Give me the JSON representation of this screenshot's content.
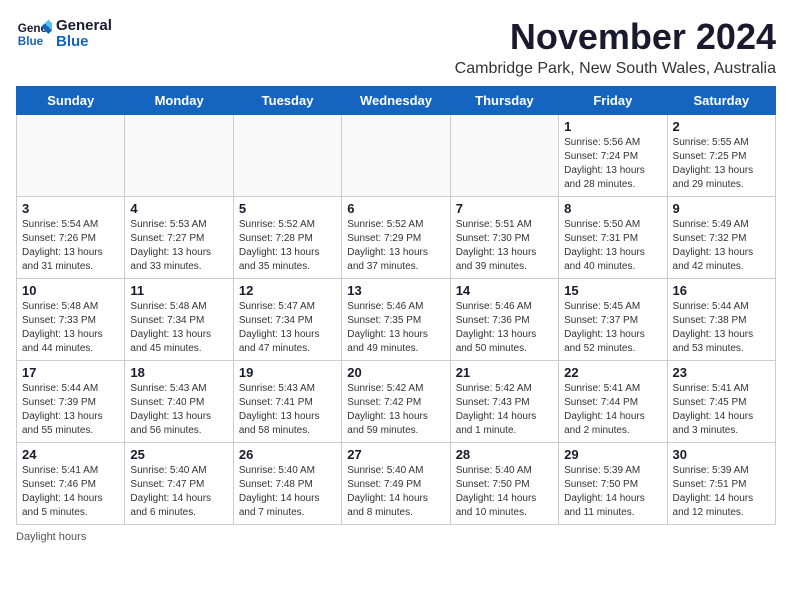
{
  "header": {
    "logo_line1": "General",
    "logo_line2": "Blue",
    "main_title": "November 2024",
    "subtitle": "Cambridge Park, New South Wales, Australia"
  },
  "calendar": {
    "days_of_week": [
      "Sunday",
      "Monday",
      "Tuesday",
      "Wednesday",
      "Thursday",
      "Friday",
      "Saturday"
    ],
    "weeks": [
      [
        {
          "date": "",
          "info": ""
        },
        {
          "date": "",
          "info": ""
        },
        {
          "date": "",
          "info": ""
        },
        {
          "date": "",
          "info": ""
        },
        {
          "date": "",
          "info": ""
        },
        {
          "date": "1",
          "info": "Sunrise: 5:56 AM\nSunset: 7:24 PM\nDaylight: 13 hours and 28 minutes."
        },
        {
          "date": "2",
          "info": "Sunrise: 5:55 AM\nSunset: 7:25 PM\nDaylight: 13 hours and 29 minutes."
        }
      ],
      [
        {
          "date": "3",
          "info": "Sunrise: 5:54 AM\nSunset: 7:26 PM\nDaylight: 13 hours and 31 minutes."
        },
        {
          "date": "4",
          "info": "Sunrise: 5:53 AM\nSunset: 7:27 PM\nDaylight: 13 hours and 33 minutes."
        },
        {
          "date": "5",
          "info": "Sunrise: 5:52 AM\nSunset: 7:28 PM\nDaylight: 13 hours and 35 minutes."
        },
        {
          "date": "6",
          "info": "Sunrise: 5:52 AM\nSunset: 7:29 PM\nDaylight: 13 hours and 37 minutes."
        },
        {
          "date": "7",
          "info": "Sunrise: 5:51 AM\nSunset: 7:30 PM\nDaylight: 13 hours and 39 minutes."
        },
        {
          "date": "8",
          "info": "Sunrise: 5:50 AM\nSunset: 7:31 PM\nDaylight: 13 hours and 40 minutes."
        },
        {
          "date": "9",
          "info": "Sunrise: 5:49 AM\nSunset: 7:32 PM\nDaylight: 13 hours and 42 minutes."
        }
      ],
      [
        {
          "date": "10",
          "info": "Sunrise: 5:48 AM\nSunset: 7:33 PM\nDaylight: 13 hours and 44 minutes."
        },
        {
          "date": "11",
          "info": "Sunrise: 5:48 AM\nSunset: 7:34 PM\nDaylight: 13 hours and 45 minutes."
        },
        {
          "date": "12",
          "info": "Sunrise: 5:47 AM\nSunset: 7:34 PM\nDaylight: 13 hours and 47 minutes."
        },
        {
          "date": "13",
          "info": "Sunrise: 5:46 AM\nSunset: 7:35 PM\nDaylight: 13 hours and 49 minutes."
        },
        {
          "date": "14",
          "info": "Sunrise: 5:46 AM\nSunset: 7:36 PM\nDaylight: 13 hours and 50 minutes."
        },
        {
          "date": "15",
          "info": "Sunrise: 5:45 AM\nSunset: 7:37 PM\nDaylight: 13 hours and 52 minutes."
        },
        {
          "date": "16",
          "info": "Sunrise: 5:44 AM\nSunset: 7:38 PM\nDaylight: 13 hours and 53 minutes."
        }
      ],
      [
        {
          "date": "17",
          "info": "Sunrise: 5:44 AM\nSunset: 7:39 PM\nDaylight: 13 hours and 55 minutes."
        },
        {
          "date": "18",
          "info": "Sunrise: 5:43 AM\nSunset: 7:40 PM\nDaylight: 13 hours and 56 minutes."
        },
        {
          "date": "19",
          "info": "Sunrise: 5:43 AM\nSunset: 7:41 PM\nDaylight: 13 hours and 58 minutes."
        },
        {
          "date": "20",
          "info": "Sunrise: 5:42 AM\nSunset: 7:42 PM\nDaylight: 13 hours and 59 minutes."
        },
        {
          "date": "21",
          "info": "Sunrise: 5:42 AM\nSunset: 7:43 PM\nDaylight: 14 hours and 1 minute."
        },
        {
          "date": "22",
          "info": "Sunrise: 5:41 AM\nSunset: 7:44 PM\nDaylight: 14 hours and 2 minutes."
        },
        {
          "date": "23",
          "info": "Sunrise: 5:41 AM\nSunset: 7:45 PM\nDaylight: 14 hours and 3 minutes."
        }
      ],
      [
        {
          "date": "24",
          "info": "Sunrise: 5:41 AM\nSunset: 7:46 PM\nDaylight: 14 hours and 5 minutes."
        },
        {
          "date": "25",
          "info": "Sunrise: 5:40 AM\nSunset: 7:47 PM\nDaylight: 14 hours and 6 minutes."
        },
        {
          "date": "26",
          "info": "Sunrise: 5:40 AM\nSunset: 7:48 PM\nDaylight: 14 hours and 7 minutes."
        },
        {
          "date": "27",
          "info": "Sunrise: 5:40 AM\nSunset: 7:49 PM\nDaylight: 14 hours and 8 minutes."
        },
        {
          "date": "28",
          "info": "Sunrise: 5:40 AM\nSunset: 7:50 PM\nDaylight: 14 hours and 10 minutes."
        },
        {
          "date": "29",
          "info": "Sunrise: 5:39 AM\nSunset: 7:50 PM\nDaylight: 14 hours and 11 minutes."
        },
        {
          "date": "30",
          "info": "Sunrise: 5:39 AM\nSunset: 7:51 PM\nDaylight: 14 hours and 12 minutes."
        }
      ]
    ]
  },
  "footer": {
    "note": "Daylight hours"
  }
}
